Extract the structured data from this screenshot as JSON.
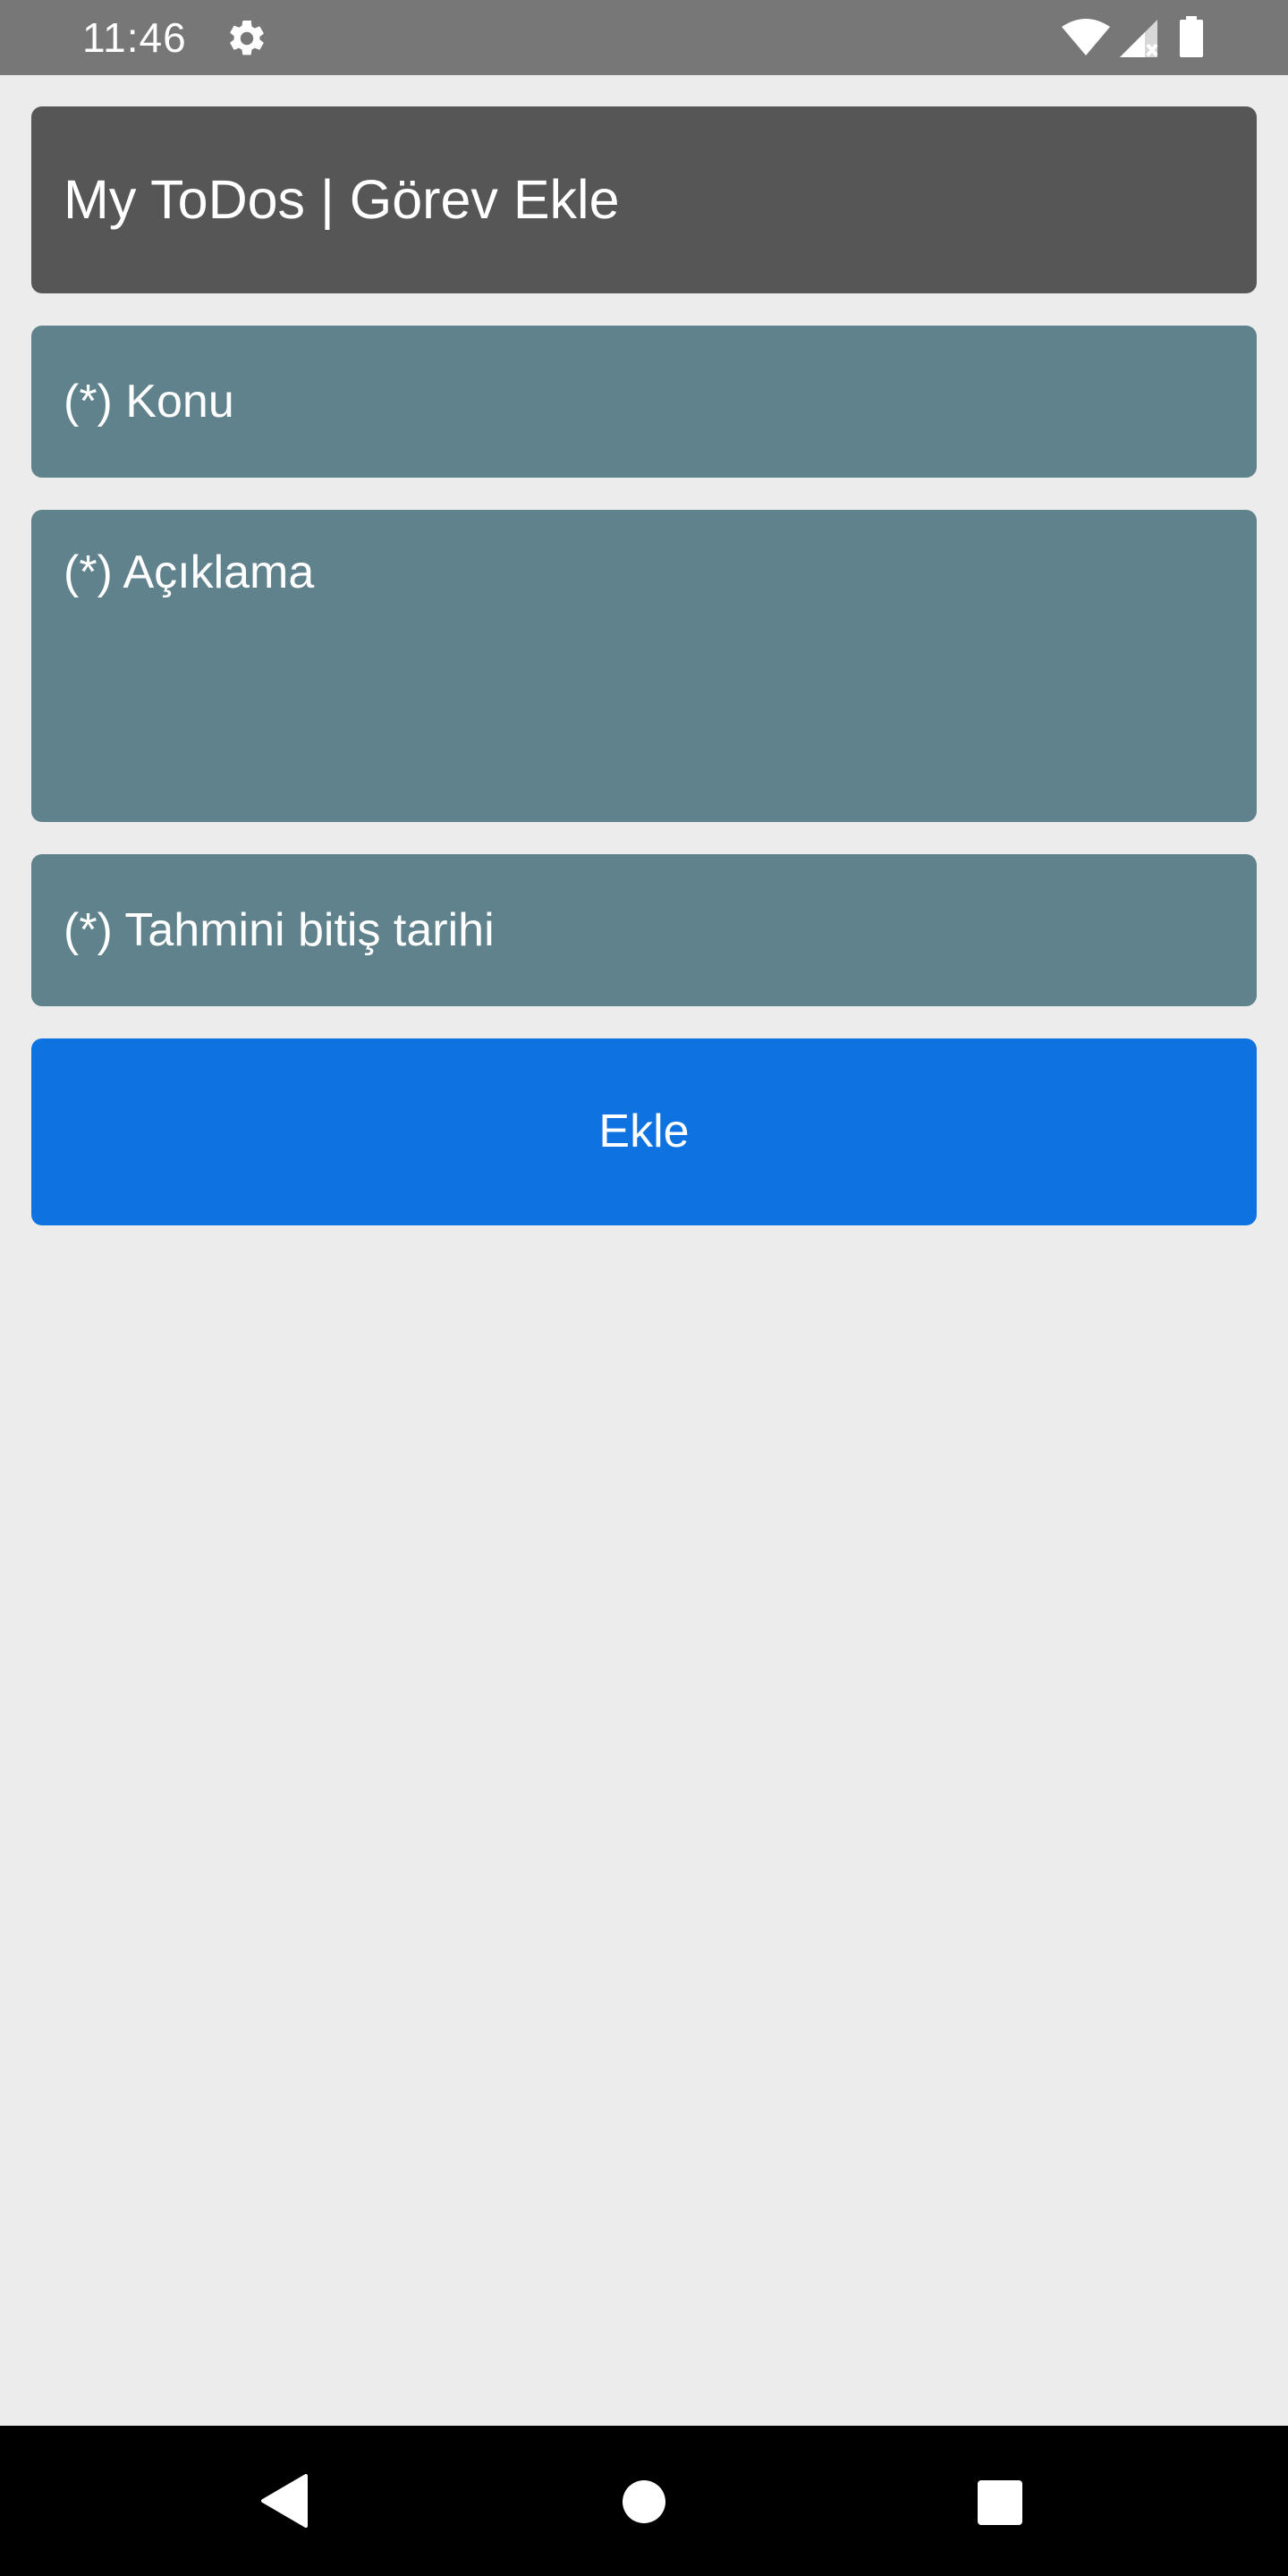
{
  "status_bar": {
    "time": "11:46",
    "icons": [
      "gear-icon",
      "wifi-icon",
      "signal-icon",
      "battery-icon"
    ]
  },
  "header": {
    "title": "My ToDos | Görev Ekle"
  },
  "form": {
    "subject_placeholder": "(*) Konu",
    "description_placeholder": "(*) Açıklama",
    "date_placeholder": "(*) Tahmini bitiş tarihi",
    "add_button_label": "Ekle"
  },
  "nav_bar": {
    "icons": [
      "back-icon",
      "home-icon",
      "recents-icon"
    ]
  },
  "colors": {
    "status_bar": "#777777",
    "background": "#ececec",
    "header": "#565656",
    "field": "#5f828d",
    "button": "#0e73e1",
    "nav_bar": "#000000"
  }
}
